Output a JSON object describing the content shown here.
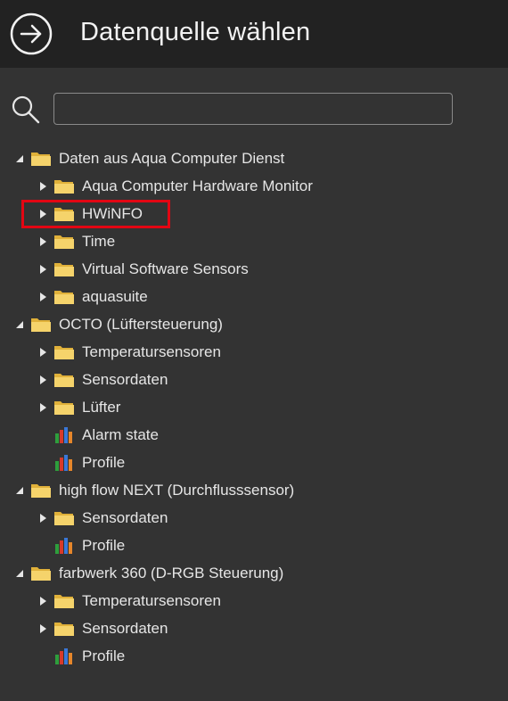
{
  "header": {
    "title": "Datenquelle wählen"
  },
  "search": {
    "placeholder": "",
    "value": ""
  },
  "tree": {
    "dienst": {
      "label": "Daten aus Aqua Computer Dienst",
      "children": {
        "hwmonitor": "Aqua Computer Hardware Monitor",
        "hwinfo": "HWiNFO",
        "time": "Time",
        "virtual": "Virtual Software Sensors",
        "aquasuite": "aquasuite"
      }
    },
    "octo": {
      "label": "OCTO (Lüftersteuerung)",
      "children": {
        "temp": "Temperatursensoren",
        "sensor": "Sensordaten",
        "fan": "Lüfter",
        "alarm": "Alarm state",
        "profile": "Profile"
      }
    },
    "highflow": {
      "label": "high flow NEXT (Durchflusssensor)",
      "children": {
        "sensor": "Sensordaten",
        "profile": "Profile"
      }
    },
    "farbwerk": {
      "label": "farbwerk 360 (D-RGB Steuerung)",
      "children": {
        "temp": "Temperatursensoren",
        "sensor": "Sensordaten",
        "profile": "Profile"
      }
    }
  },
  "colors": {
    "highlight": "#e30613",
    "folder": "#f2c94c"
  }
}
